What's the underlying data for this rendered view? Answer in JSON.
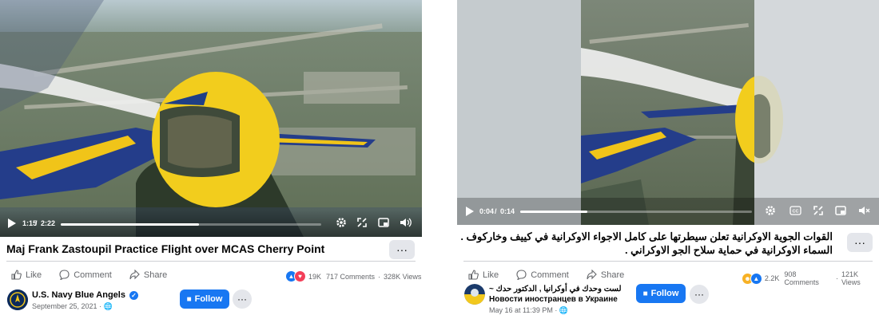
{
  "posts": [
    {
      "time_current": "1:15",
      "time_total": "2:22",
      "progress": 0.53,
      "title": "Maj Frank Zastoupil Practice Flight over MCAS Cherry Point",
      "actions": {
        "like": "Like",
        "comment": "Comment",
        "share": "Share"
      },
      "reactions_count": "19K",
      "comments": "717 Comments",
      "views": "328K Views",
      "page_name": "U.S. Navy Blue Angels",
      "date": "September 25, 2021",
      "follow": "Follow",
      "more": "···"
    },
    {
      "time_current": "0:04",
      "time_total": "0:14",
      "progress": 0.29,
      "title_line1": "القوات الجوية الاوكرانية تعلن سيطرتها على كامل الاجواء الاوكرانية في كييف وخاركوف .",
      "title_line2": "السماء الاوكرانية في حماية سلاح الجو الاوكراني .",
      "actions": {
        "like": "Like",
        "comment": "Comment",
        "share": "Share"
      },
      "reactions_count": "2.2K",
      "comments": "908 Comments",
      "views": "121K Views",
      "page_name_line1": "لست وحدك في أوكرانيا , الدكتور حدك ~",
      "page_name_line2": "Новости иностранцев в Украине",
      "date": "May 16 at 11:39 PM",
      "follow": "Follow",
      "more": "···"
    }
  ],
  "colors": {
    "accent": "#1877f2",
    "secondary_text": "#65676b",
    "button_bg": "#e4e6eb"
  }
}
